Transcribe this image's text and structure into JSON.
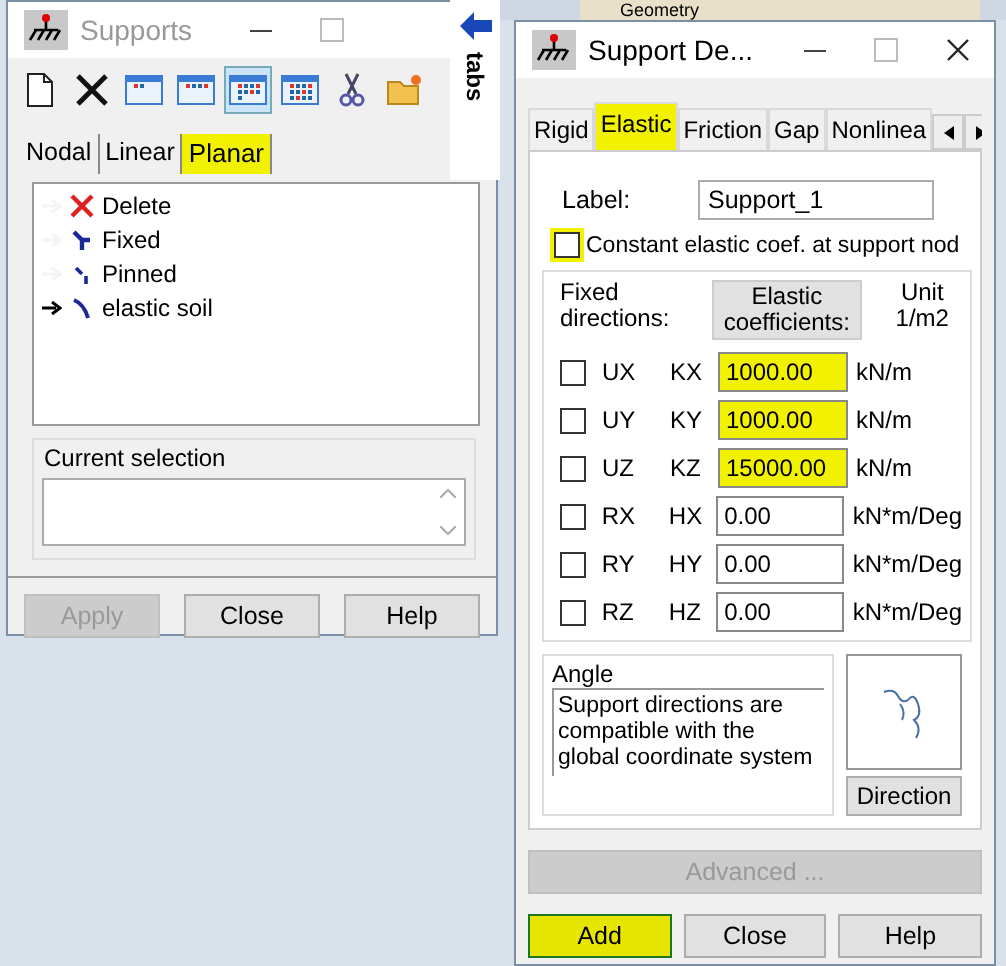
{
  "background": {
    "combo": "Geometry"
  },
  "supports_window": {
    "title": "Supports",
    "toolbar": [
      {
        "kind": "new",
        "selected": false
      },
      {
        "kind": "delete",
        "selected": false
      },
      {
        "kind": "view1",
        "selected": false
      },
      {
        "kind": "view2",
        "selected": false
      },
      {
        "kind": "view3",
        "selected": true
      },
      {
        "kind": "view4",
        "selected": false
      },
      {
        "kind": "cut",
        "selected": false
      },
      {
        "kind": "open",
        "selected": false
      }
    ],
    "tabs": [
      {
        "label": "Nodal",
        "selected": false,
        "highlighted": false
      },
      {
        "label": "Linear",
        "selected": false,
        "highlighted": false
      },
      {
        "label": "Planar",
        "selected": true,
        "highlighted": true
      }
    ],
    "list": [
      {
        "label": "Delete",
        "kind": "delete",
        "current": false
      },
      {
        "label": "Fixed",
        "kind": "fixed",
        "current": false
      },
      {
        "label": "Pinned",
        "kind": "pinned",
        "current": false
      },
      {
        "label": "elastic soil",
        "kind": "elastic",
        "current": true
      }
    ],
    "selection_group": {
      "title": "Current selection"
    },
    "buttons": [
      {
        "label": "Apply",
        "disabled": true
      },
      {
        "label": "Close",
        "disabled": false
      },
      {
        "label": "Help",
        "disabled": false
      }
    ]
  },
  "side_tab": {
    "label": "tabs"
  },
  "definition_window": {
    "title": "Support De...",
    "tabs": [
      {
        "label": "Rigid",
        "selected": false,
        "highlighted": false
      },
      {
        "label": "Elastic",
        "selected": true,
        "highlighted": true
      },
      {
        "label": "Friction",
        "selected": false,
        "highlighted": false
      },
      {
        "label": "Gap",
        "selected": false,
        "highlighted": false
      },
      {
        "label": "Nonlinea",
        "selected": false,
        "highlighted": false
      }
    ],
    "label_field": {
      "label": "Label:",
      "value": "Support_1"
    },
    "constant_checkbox": {
      "label": "Constant elastic coef. at support nod",
      "checked": false,
      "highlighted": true
    },
    "headers": {
      "fixed": "Fixed directions:",
      "coefficients": "Elastic coefficients:",
      "unit": "Unit 1/m2"
    },
    "rows": [
      {
        "direction": "UX",
        "checked": false,
        "coef": "KX",
        "value": "1000.00",
        "unit": "kN/m",
        "highlighted": true
      },
      {
        "direction": "UY",
        "checked": false,
        "coef": "KY",
        "value": "1000.00",
        "unit": "kN/m",
        "highlighted": true
      },
      {
        "direction": "UZ",
        "checked": false,
        "coef": "KZ",
        "value": "15000.00",
        "unit": "kN/m",
        "highlighted": true
      },
      {
        "direction": "RX",
        "checked": false,
        "coef": "HX",
        "value": "0.00",
        "unit": "kN*m/Deg",
        "highlighted": false
      },
      {
        "direction": "RY",
        "checked": false,
        "coef": "HY",
        "value": "0.00",
        "unit": "kN*m/Deg",
        "highlighted": false
      },
      {
        "direction": "RZ",
        "checked": false,
        "coef": "HZ",
        "value": "0.00",
        "unit": "kN*m/Deg",
        "highlighted": false
      }
    ],
    "angle": {
      "title": "Angle",
      "text": "Support directions are compatible with the global coordinate system"
    },
    "direction_button": "Direction",
    "advanced_button": {
      "label": "Advanced ...",
      "disabled": true
    },
    "buttons": [
      {
        "label": "Add",
        "disabled": false,
        "highlighted": true
      },
      {
        "label": "Close",
        "disabled": false,
        "highlighted": false
      },
      {
        "label": "Help",
        "disabled": false,
        "highlighted": false
      }
    ]
  }
}
